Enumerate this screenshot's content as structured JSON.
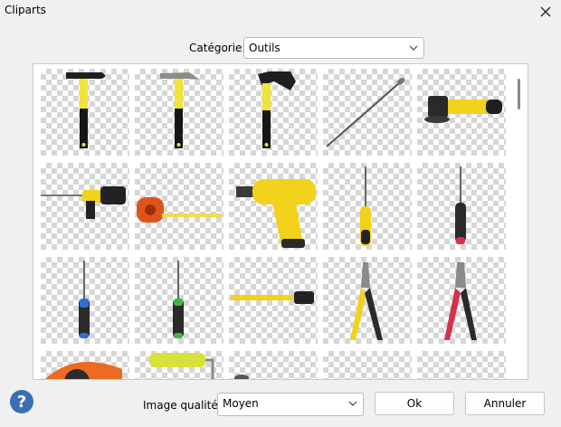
{
  "window": {
    "title": "Cliparts"
  },
  "category": {
    "label": "Catégorie:",
    "value": "Outils"
  },
  "quality": {
    "label": "Image qualité:",
    "value": "Moyen"
  },
  "buttons": {
    "ok": "Ok",
    "cancel": "Annuler"
  },
  "icons": {
    "close": "close-icon",
    "help": "help-icon",
    "dropdown": "chevron-down-icon"
  },
  "colors": {
    "accent_yellow": "#f2d21a",
    "help_blue": "#3a6fb6",
    "tool_black": "#1f1f1f"
  },
  "cliparts": [
    "hammer",
    "claw-hammer",
    "axe",
    "nail",
    "angle-grinder",
    "rotary-hammer-drill",
    "tape-measure",
    "power-drill",
    "yellow-screwdriver",
    "red-screwdriver",
    "blue-screwdriver",
    "green-screwdriver",
    "measuring-tape-ruler",
    "yellow-pliers",
    "red-pliers",
    "circular-saw",
    "paint-roller",
    "tool-partial",
    "empty-tile",
    "empty-tile"
  ]
}
